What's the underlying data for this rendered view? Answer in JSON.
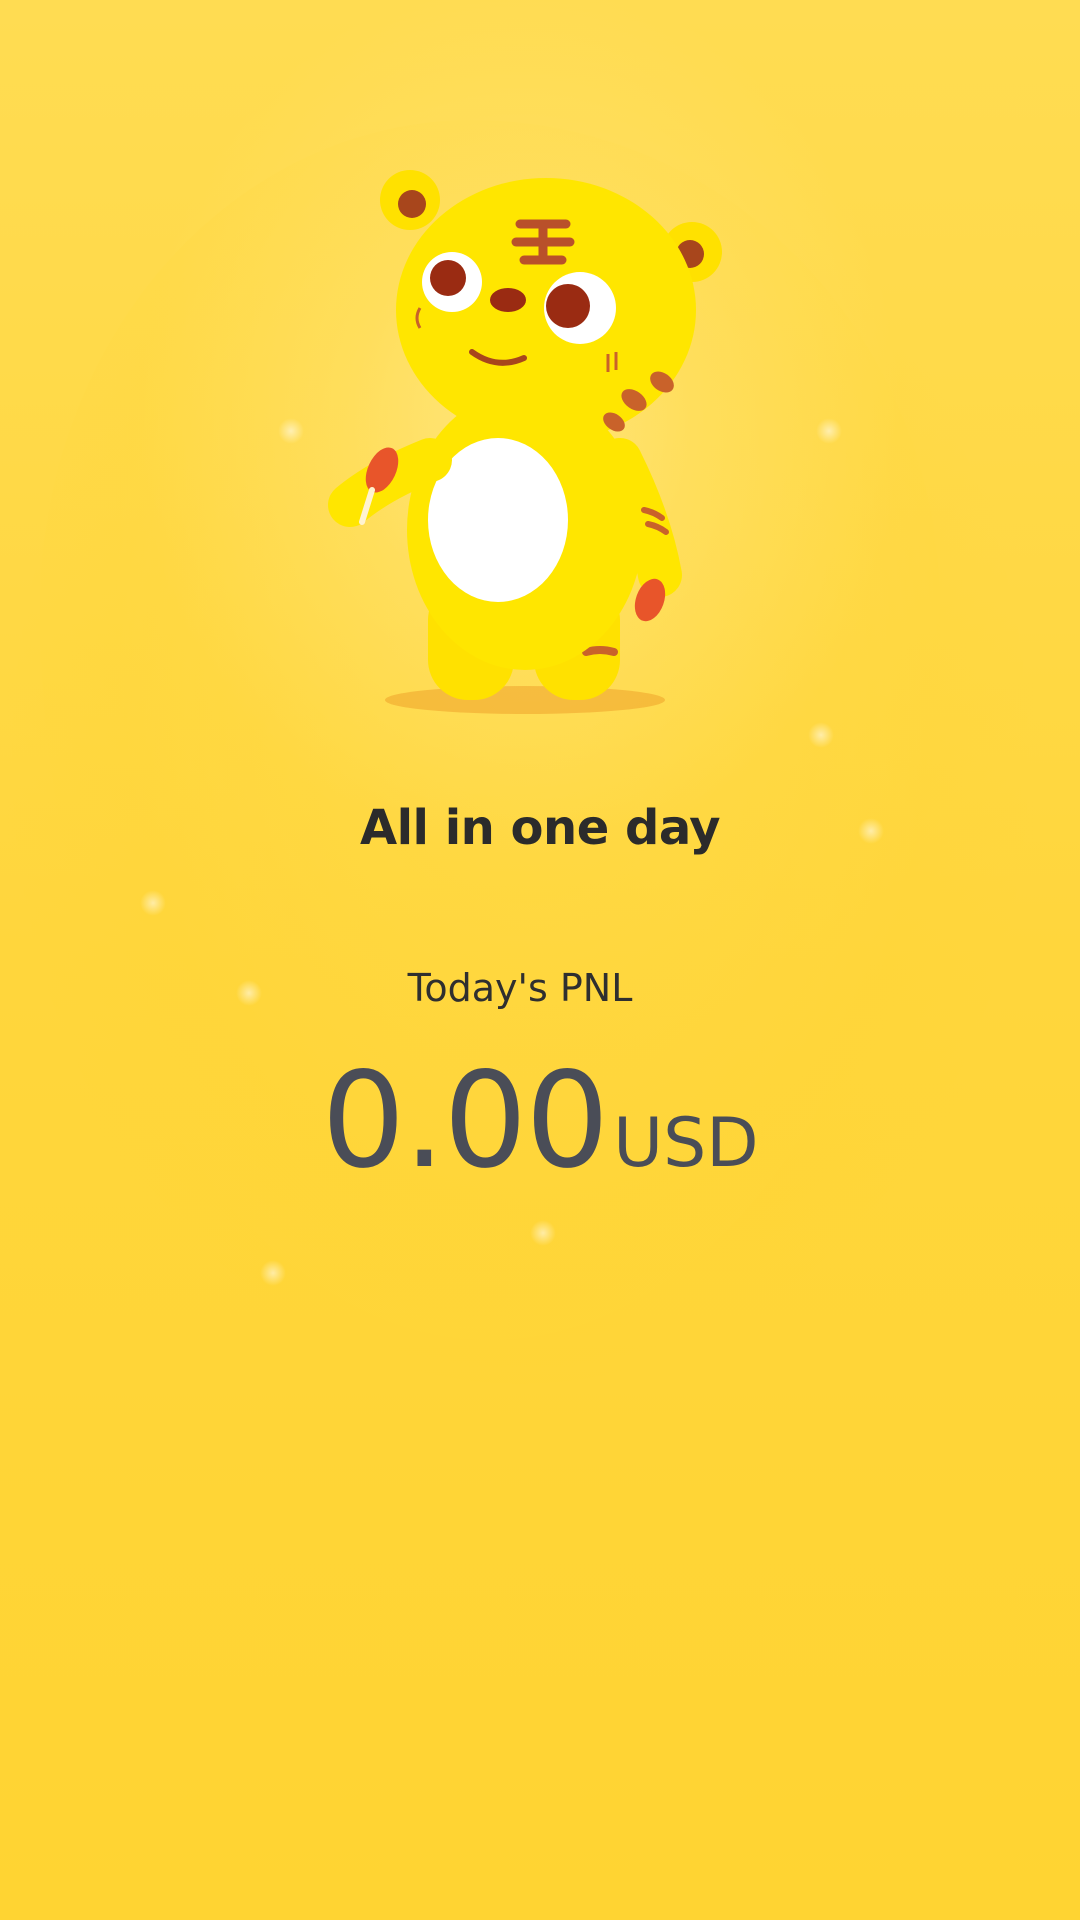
{
  "headline": "All in one day",
  "pnl": {
    "label": "Today's PNL",
    "value": "0.00",
    "unit": "USD"
  },
  "mascot": {
    "icon": "tiger-mascot-icon"
  },
  "colors": {
    "background": "#ffd83a",
    "text_dark": "#2b2b2b",
    "value_text": "#4a4d57",
    "mascot_body": "#ffe600",
    "mascot_belly": "#ffffff",
    "mascot_stripes": "#c9622a"
  }
}
